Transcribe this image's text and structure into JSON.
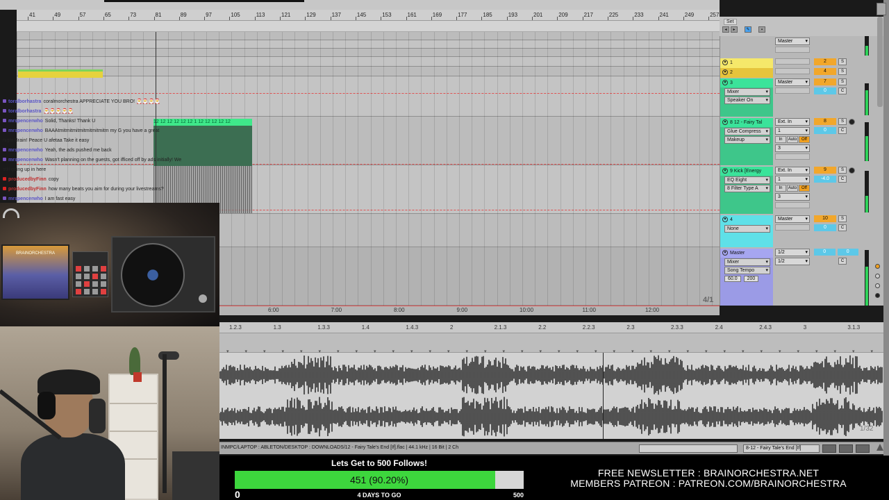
{
  "ruler": {
    "bars": [
      "41",
      "49",
      "57",
      "65",
      "73",
      "81",
      "89",
      "97",
      "105",
      "113",
      "121",
      "129",
      "137",
      "145",
      "153",
      "161",
      "169",
      "177",
      "185",
      "193",
      "201",
      "209",
      "217",
      "225",
      "233",
      "241",
      "249",
      "257"
    ]
  },
  "arrangement": {
    "time_marks": [
      "6:00",
      "7:00",
      "8:00",
      "9:00",
      "10:00",
      "11:00",
      "12:00"
    ],
    "time_signature": "4/1",
    "clip_label": "12  12 12 12  12 12 1  12 12 12  12 12"
  },
  "chat": [
    {
      "user": "toralborhastra",
      "text": "coralmorchestra APPRECIATE YOU BRO! 🎅🎅🎅🎅",
      "dot": "purple"
    },
    {
      "user": "toralborhastra",
      "text": "🎅🎅🎅🎅🎅",
      "dot": "purple"
    },
    {
      "user": "mrspencerwho",
      "text": "Solid, Thanks! Thank U",
      "dot": "purple"
    },
    {
      "user": "mrspencerwho",
      "text": "BAAAtmitmitmitmitmitmitmitm my G you have a great",
      "dot": "purple"
    },
    {
      "user": "",
      "text": "night Brain! Peace U afetaa Take it easy",
      "dot": ""
    },
    {
      "user": "mrspencerwho",
      "text": "Yeah, the ads pushed me back",
      "dot": "purple"
    },
    {
      "user": "mrspencerwho",
      "text": "Wasn't planning on the guests, got ifficed off by ads initially! We",
      "dot": "purple"
    },
    {
      "user": "",
      "text": "still going up in here",
      "dot": ""
    },
    {
      "user": "producedbyFinn",
      "text": "copy",
      "dot": "red"
    },
    {
      "user": "producedbyFinn",
      "text": "how many beats you aim for during your livestreams?",
      "dot": "red"
    },
    {
      "user": "mrspencerwho",
      "text": "I am fast easy",
      "dot": "purple"
    }
  ],
  "camera": {
    "poster_text": "BRAINORCHESTRA"
  },
  "mixer": {
    "set_label": "Set",
    "tracks": [
      {
        "name": "1",
        "color": "#f5e86a",
        "number": "2"
      },
      {
        "name": "2",
        "color": "#e6c43c",
        "number": "4"
      },
      {
        "name": "3",
        "color": "#3be39a",
        "number": "7",
        "output": "Master",
        "volume": "0",
        "devices": [
          "Mixer",
          "Speaker On"
        ]
      },
      {
        "name": "8 12 - Fairy Tal",
        "color": "#3be39a",
        "number": "8",
        "input": "Ext. In",
        "input_ch": "1",
        "volume": "0",
        "devices": [
          "Glue Compress",
          "Makeup"
        ],
        "monitor": [
          "In",
          "Auto",
          "Off"
        ],
        "sub": "3"
      },
      {
        "name": "9 Kick [Energy",
        "color": "#3be39a",
        "number": "9",
        "input": "Ext. In",
        "input_ch": "1",
        "volume": "-4.0",
        "devices": [
          "EQ Eight",
          "8 Filter Type A"
        ],
        "monitor": [
          "In",
          "Auto",
          "Off"
        ],
        "sub": "3"
      },
      {
        "name": "4",
        "color": "#5fe0e8",
        "number": "10",
        "output": "Master",
        "volume": "0",
        "devices": [
          "None"
        ]
      },
      {
        "name": "Master",
        "color": "#a6a6f0",
        "output": "1/2",
        "output2": "1/2",
        "volume": "0",
        "volume2": "0",
        "devices": [
          "Mixer",
          "Song Tempo"
        ],
        "tempo_min": "60.0",
        "tempo_max": "200"
      }
    ],
    "master_out": "Master",
    "s_label": "S",
    "c_label": "C"
  },
  "detail": {
    "ruler": [
      "1.2.3",
      "1.3",
      "1.3.3",
      "1.4",
      "1.4.3",
      "2",
      "2.1.3",
      "2.2",
      "2.2.3",
      "2.3",
      "2.3.3",
      "2.4",
      "2.4.3",
      "3",
      "3.1.3"
    ],
    "zoom": "1/32"
  },
  "status": {
    "path": "INMPC/LAPTOP : ABLETON/DESKTOP : DOWNLOADS/12 - Fairy Tale's End [If].flac | 44.1 kHz | 16 Bit | 2 Ch",
    "track_name": "8-12 - Fairy Tale's End [If]"
  },
  "goal": {
    "title": "Lets Get to 500 Follows!",
    "current": 451,
    "target": 500,
    "min": "0",
    "max": "500",
    "progress_text": "451 (90.20%)",
    "progress": 0.902,
    "days_left": "4 DAYS TO GO"
  },
  "promo": {
    "line1": "FREE NEWSLETTER : BRAINORCHESTRA.NET",
    "line2": "MEMBERS PATREON : PATREON.COM/BRAINORCHESTRA"
  }
}
